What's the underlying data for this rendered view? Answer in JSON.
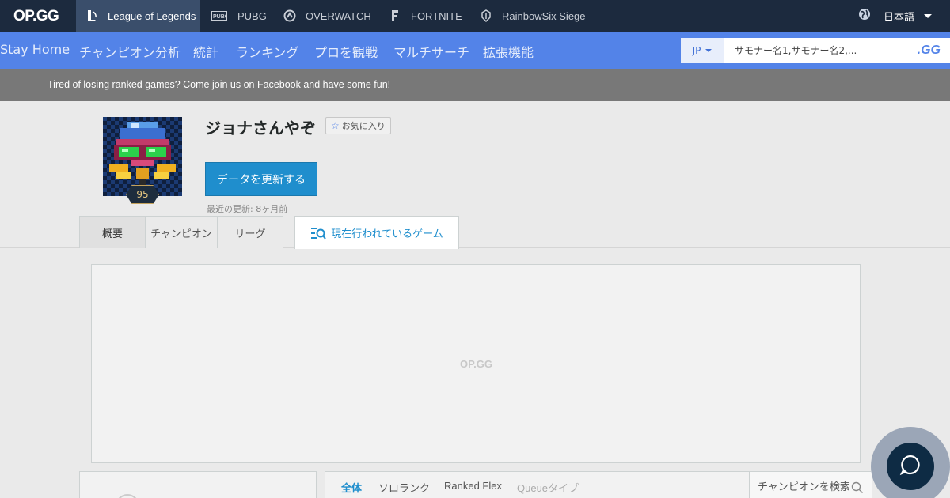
{
  "topbar": {
    "logo": "OP.GG",
    "games": [
      {
        "label": "League of Legends",
        "icon": "lol-icon",
        "active": true
      },
      {
        "label": "PUBG",
        "icon": "pubg-icon"
      },
      {
        "label": "OVERWATCH",
        "icon": "overwatch-icon"
      },
      {
        "label": "FORTNITE",
        "icon": "fortnite-icon"
      },
      {
        "label": "RainbowSix Siege",
        "icon": "r6-icon"
      }
    ],
    "language": "日本語"
  },
  "nav": {
    "items": [
      "Stay Home",
      "チャンピオン分析",
      "統計",
      "ランキング",
      "プロを観戦",
      "マルチサーチ",
      "拡張機能"
    ],
    "region": "JP",
    "search_placeholder": "サモナー名1,サモナー名2,...",
    "search_button": ".GG"
  },
  "banner": {
    "text": "Tired of losing ranked games? Come join us on Facebook and have some fun!"
  },
  "profile": {
    "level": "95",
    "summoner_name": "ジョナさんやぞ",
    "favorite_label": "お気に入り",
    "update_button": "データを更新する",
    "last_update": "最近の更新: 8ヶ月前",
    "tabs": [
      "概要",
      "チャンピオン",
      "リーグ"
    ],
    "live_tab": "現在行われているゲーム"
  },
  "ad": {
    "logo": "OP.GG"
  },
  "matches": {
    "queue_tabs": [
      "全体",
      "ソロランク",
      "Ranked Flex",
      "Queueタイプ"
    ],
    "champion_search_placeholder": "チャンピオンを検索"
  },
  "colors": {
    "topbar": "#1c2a3e",
    "nav": "#5383e8",
    "accent": "#1f8ecd"
  }
}
